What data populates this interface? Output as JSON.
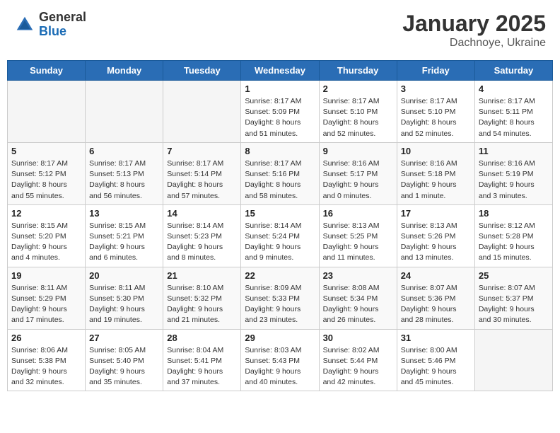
{
  "logo": {
    "general": "General",
    "blue": "Blue"
  },
  "header": {
    "title": "January 2025",
    "subtitle": "Dachnoye, Ukraine"
  },
  "weekdays": [
    "Sunday",
    "Monday",
    "Tuesday",
    "Wednesday",
    "Thursday",
    "Friday",
    "Saturday"
  ],
  "weeks": [
    [
      {
        "day": "",
        "info": ""
      },
      {
        "day": "",
        "info": ""
      },
      {
        "day": "",
        "info": ""
      },
      {
        "day": "1",
        "info": "Sunrise: 8:17 AM\nSunset: 5:09 PM\nDaylight: 8 hours and 51 minutes."
      },
      {
        "day": "2",
        "info": "Sunrise: 8:17 AM\nSunset: 5:10 PM\nDaylight: 8 hours and 52 minutes."
      },
      {
        "day": "3",
        "info": "Sunrise: 8:17 AM\nSunset: 5:10 PM\nDaylight: 8 hours and 52 minutes."
      },
      {
        "day": "4",
        "info": "Sunrise: 8:17 AM\nSunset: 5:11 PM\nDaylight: 8 hours and 54 minutes."
      }
    ],
    [
      {
        "day": "5",
        "info": "Sunrise: 8:17 AM\nSunset: 5:12 PM\nDaylight: 8 hours and 55 minutes."
      },
      {
        "day": "6",
        "info": "Sunrise: 8:17 AM\nSunset: 5:13 PM\nDaylight: 8 hours and 56 minutes."
      },
      {
        "day": "7",
        "info": "Sunrise: 8:17 AM\nSunset: 5:14 PM\nDaylight: 8 hours and 57 minutes."
      },
      {
        "day": "8",
        "info": "Sunrise: 8:17 AM\nSunset: 5:16 PM\nDaylight: 8 hours and 58 minutes."
      },
      {
        "day": "9",
        "info": "Sunrise: 8:16 AM\nSunset: 5:17 PM\nDaylight: 9 hours and 0 minutes."
      },
      {
        "day": "10",
        "info": "Sunrise: 8:16 AM\nSunset: 5:18 PM\nDaylight: 9 hours and 1 minute."
      },
      {
        "day": "11",
        "info": "Sunrise: 8:16 AM\nSunset: 5:19 PM\nDaylight: 9 hours and 3 minutes."
      }
    ],
    [
      {
        "day": "12",
        "info": "Sunrise: 8:15 AM\nSunset: 5:20 PM\nDaylight: 9 hours and 4 minutes."
      },
      {
        "day": "13",
        "info": "Sunrise: 8:15 AM\nSunset: 5:21 PM\nDaylight: 9 hours and 6 minutes."
      },
      {
        "day": "14",
        "info": "Sunrise: 8:14 AM\nSunset: 5:23 PM\nDaylight: 9 hours and 8 minutes."
      },
      {
        "day": "15",
        "info": "Sunrise: 8:14 AM\nSunset: 5:24 PM\nDaylight: 9 hours and 9 minutes."
      },
      {
        "day": "16",
        "info": "Sunrise: 8:13 AM\nSunset: 5:25 PM\nDaylight: 9 hours and 11 minutes."
      },
      {
        "day": "17",
        "info": "Sunrise: 8:13 AM\nSunset: 5:26 PM\nDaylight: 9 hours and 13 minutes."
      },
      {
        "day": "18",
        "info": "Sunrise: 8:12 AM\nSunset: 5:28 PM\nDaylight: 9 hours and 15 minutes."
      }
    ],
    [
      {
        "day": "19",
        "info": "Sunrise: 8:11 AM\nSunset: 5:29 PM\nDaylight: 9 hours and 17 minutes."
      },
      {
        "day": "20",
        "info": "Sunrise: 8:11 AM\nSunset: 5:30 PM\nDaylight: 9 hours and 19 minutes."
      },
      {
        "day": "21",
        "info": "Sunrise: 8:10 AM\nSunset: 5:32 PM\nDaylight: 9 hours and 21 minutes."
      },
      {
        "day": "22",
        "info": "Sunrise: 8:09 AM\nSunset: 5:33 PM\nDaylight: 9 hours and 23 minutes."
      },
      {
        "day": "23",
        "info": "Sunrise: 8:08 AM\nSunset: 5:34 PM\nDaylight: 9 hours and 26 minutes."
      },
      {
        "day": "24",
        "info": "Sunrise: 8:07 AM\nSunset: 5:36 PM\nDaylight: 9 hours and 28 minutes."
      },
      {
        "day": "25",
        "info": "Sunrise: 8:07 AM\nSunset: 5:37 PM\nDaylight: 9 hours and 30 minutes."
      }
    ],
    [
      {
        "day": "26",
        "info": "Sunrise: 8:06 AM\nSunset: 5:38 PM\nDaylight: 9 hours and 32 minutes."
      },
      {
        "day": "27",
        "info": "Sunrise: 8:05 AM\nSunset: 5:40 PM\nDaylight: 9 hours and 35 minutes."
      },
      {
        "day": "28",
        "info": "Sunrise: 8:04 AM\nSunset: 5:41 PM\nDaylight: 9 hours and 37 minutes."
      },
      {
        "day": "29",
        "info": "Sunrise: 8:03 AM\nSunset: 5:43 PM\nDaylight: 9 hours and 40 minutes."
      },
      {
        "day": "30",
        "info": "Sunrise: 8:02 AM\nSunset: 5:44 PM\nDaylight: 9 hours and 42 minutes."
      },
      {
        "day": "31",
        "info": "Sunrise: 8:00 AM\nSunset: 5:46 PM\nDaylight: 9 hours and 45 minutes."
      },
      {
        "day": "",
        "info": ""
      }
    ]
  ]
}
